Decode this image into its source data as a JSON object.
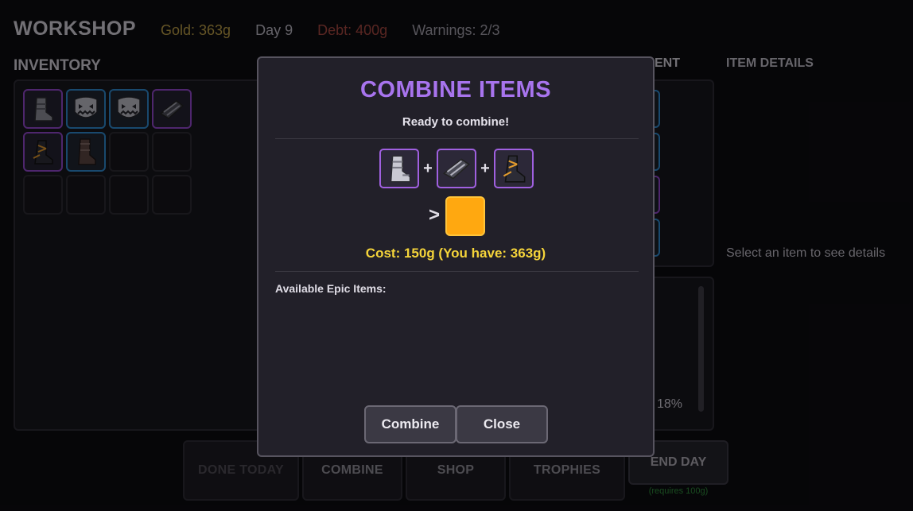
{
  "header": {
    "title": "WORKSHOP",
    "gold": "Gold: 363g",
    "day": "Day 9",
    "debt": "Debt: 400g",
    "warnings": "Warnings: 2/3"
  },
  "inventory": {
    "label": "INVENTORY",
    "slots": [
      {
        "rarity": "epic",
        "icon": "boot-icon"
      },
      {
        "rarity": "rare",
        "icon": "skull-mask-icon"
      },
      {
        "rarity": "rare",
        "icon": "skull-mask-icon"
      },
      {
        "rarity": "epic",
        "icon": "gauntlet-icon"
      },
      {
        "rarity": "epic",
        "icon": "gold-trim-boot-icon"
      },
      {
        "rarity": "rare",
        "icon": "leather-boot-icon"
      },
      {
        "rarity": "empty",
        "icon": ""
      },
      {
        "rarity": "empty",
        "icon": ""
      },
      {
        "rarity": "empty",
        "icon": ""
      },
      {
        "rarity": "empty",
        "icon": ""
      },
      {
        "rarity": "empty",
        "icon": ""
      },
      {
        "rarity": "empty",
        "icon": ""
      }
    ]
  },
  "equipment": {
    "label_fragment": "ENT",
    "stat_fragment": "18%"
  },
  "details": {
    "label": "ITEM DETAILS",
    "hint": "Select an item to see details"
  },
  "bottom": {
    "done_today": "DONE TODAY",
    "combine": "COMBINE",
    "shop": "SHOP",
    "trophies": "TROPHIES",
    "end_day": "END DAY",
    "requires": "(requires 100g)"
  },
  "modal": {
    "title": "COMBINE ITEMS",
    "status": "Ready to combine!",
    "plus": "+",
    "arrow": ">",
    "cost": "Cost: 150g (You have: 363g)",
    "available_label": "Available Epic Items:",
    "combine_button": "Combine",
    "close_button": "Close",
    "inputs": [
      "plate-boot-icon",
      "gauntlet-icon",
      "gold-trim-boot-icon"
    ],
    "result_color": "#ffa810"
  },
  "colors": {
    "epic": "#8e46c6",
    "rare": "#2f86c8",
    "gold": "#b89b45",
    "debt": "#a3463f",
    "title_purple": "#a874ee",
    "cost_yellow": "#f5d43a"
  }
}
